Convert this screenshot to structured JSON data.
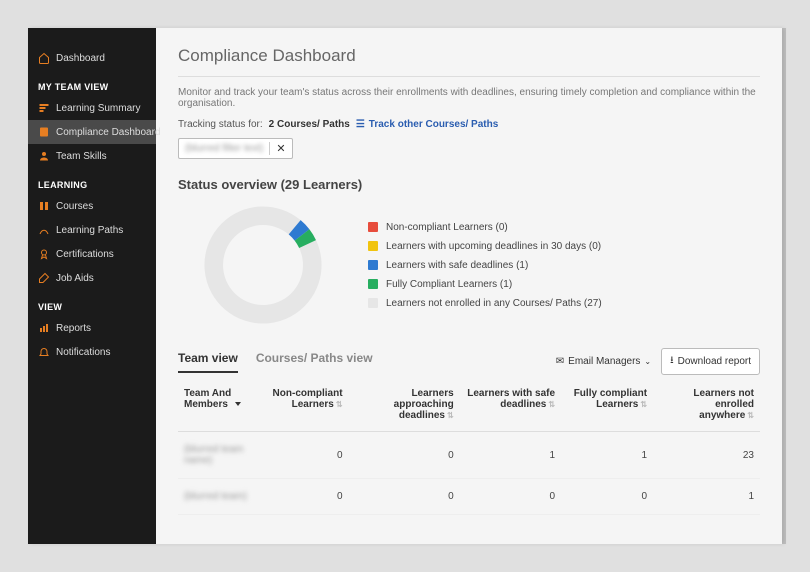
{
  "sidebar": {
    "dashboard": "Dashboard",
    "headings": {
      "myTeamView": "MY TEAM VIEW",
      "learning": "LEARNING",
      "view": "VIEW"
    },
    "items": {
      "learningSummary": "Learning Summary",
      "complianceDashboard": "Compliance Dashboard",
      "teamSkills": "Team Skills",
      "courses": "Courses",
      "learningPaths": "Learning Paths",
      "certifications": "Certifications",
      "jobAids": "Job Aids",
      "reports": "Reports",
      "notifications": "Notifications"
    }
  },
  "page": {
    "title": "Compliance Dashboard",
    "description": "Monitor and track your team's status across their enrollments with deadlines, ensuring timely completion and compliance within the organisation.",
    "trackingLabel": "Tracking status for:",
    "trackingValue": "2 Courses/ Paths",
    "trackLink": "Track other Courses/ Paths",
    "chipText": "(blurred filter text)",
    "overviewTitle": "Status overview (29 Learners)"
  },
  "legend": [
    {
      "label": "Non-compliant Learners (0)",
      "color": "#e74c3c"
    },
    {
      "label": "Learners with upcoming deadlines in 30 days (0)",
      "color": "#f1c40f"
    },
    {
      "label": "Learners with safe deadlines (1)",
      "color": "#2e7ad1"
    },
    {
      "label": "Fully Compliant Learners (1)",
      "color": "#27ae60"
    },
    {
      "label": "Learners not enrolled in any Courses/ Paths (27)",
      "color": "#e6e6e6"
    }
  ],
  "chart_data": {
    "type": "pie",
    "title": "Status overview (29 Learners)",
    "series": [
      {
        "name": "Non-compliant Learners",
        "value": 0,
        "color": "#e74c3c"
      },
      {
        "name": "Learners with upcoming deadlines in 30 days",
        "value": 0,
        "color": "#f1c40f"
      },
      {
        "name": "Learners with safe deadlines",
        "value": 1,
        "color": "#2e7ad1"
      },
      {
        "name": "Fully Compliant Learners",
        "value": 1,
        "color": "#27ae60"
      },
      {
        "name": "Learners not enrolled in any Courses/ Paths",
        "value": 27,
        "color": "#e6e6e6"
      }
    ],
    "total": 29
  },
  "tabs": {
    "teamView": "Team view",
    "coursesPathsView": "Courses/ Paths view"
  },
  "actions": {
    "emailManagers": "Email Managers",
    "downloadReport": "Download report"
  },
  "table": {
    "headers": {
      "teamAndMembers": "Team And Members",
      "nonCompliant": "Non-compliant Learners",
      "approaching": "Learners approaching deadlines",
      "safe": "Learners with safe deadlines",
      "fullyCompliant": "Fully compliant Learners",
      "notEnrolled": "Learners not enrolled anywhere"
    },
    "rows": [
      {
        "name": "(blurred team name)",
        "nonCompliant": 0,
        "approaching": 0,
        "safe": 1,
        "fullyCompliant": 1,
        "notEnrolled": 23
      },
      {
        "name": "(blurred team)",
        "nonCompliant": 0,
        "approaching": 0,
        "safe": 0,
        "fullyCompliant": 0,
        "notEnrolled": 1
      }
    ]
  },
  "colors": {
    "accentOrange": "#e67e22",
    "link": "#2a5db0"
  }
}
